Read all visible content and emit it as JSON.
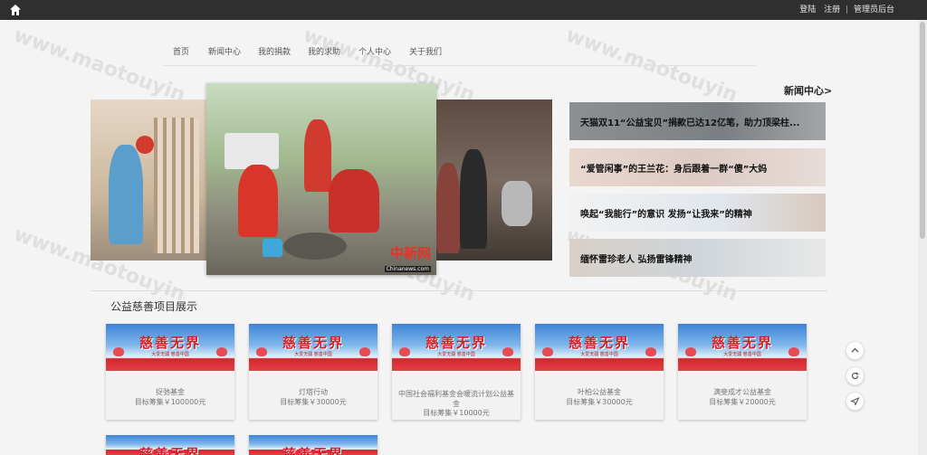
{
  "topbar": {
    "login": "登陆",
    "register": "注册",
    "separator": "|",
    "admin": "管理员后台"
  },
  "nav": [
    "首页",
    "新闻中心",
    "我的捐款",
    "我的求助",
    "个人中心",
    "关于我们"
  ],
  "carousel": {
    "center_watermark": "中新网",
    "center_watermark_sub": "Chinanews.com"
  },
  "news": {
    "heading": "新闻中心>",
    "items": [
      "天猫双11“公益宝贝”捐款已达12亿笔，助力顶梁柱...",
      "“爱管闲事”的王兰花：身后跟着一群“傻”大妈",
      "唤起“我能行”的意识 发扬“让我来”的精神",
      "缅怀雷珍老人 弘扬雷锋精神"
    ]
  },
  "section": {
    "title": "公益慈善项目展示",
    "banner_title": "慈善无界",
    "banner_sub": "大爱无疆 慈善中国",
    "projects": [
      {
        "name": "捉弛基金",
        "goal": "目标筹集￥100000元"
      },
      {
        "name": "灯塔行动",
        "goal": "目标筹集￥30000元"
      },
      {
        "name": "中国社会福利基金会暖流计划公益基金",
        "goal": "目标筹集￥10000元"
      },
      {
        "name": "叶柏公益基金",
        "goal": "目标筹集￥30000元"
      },
      {
        "name": "满斐成才公益基金",
        "goal": "目标筹集￥20000元"
      }
    ]
  },
  "watermark": "www.maotouyin... ©猫头鹰源码",
  "icons": {
    "home": "home-icon",
    "scroll_top": "chevron-up-icon",
    "refresh": "refresh-icon",
    "send": "send-icon"
  },
  "colors": {
    "topbar": "#2f2f2f",
    "banner_red": "#d11f2a",
    "page_bg": "#f4f4f4"
  }
}
